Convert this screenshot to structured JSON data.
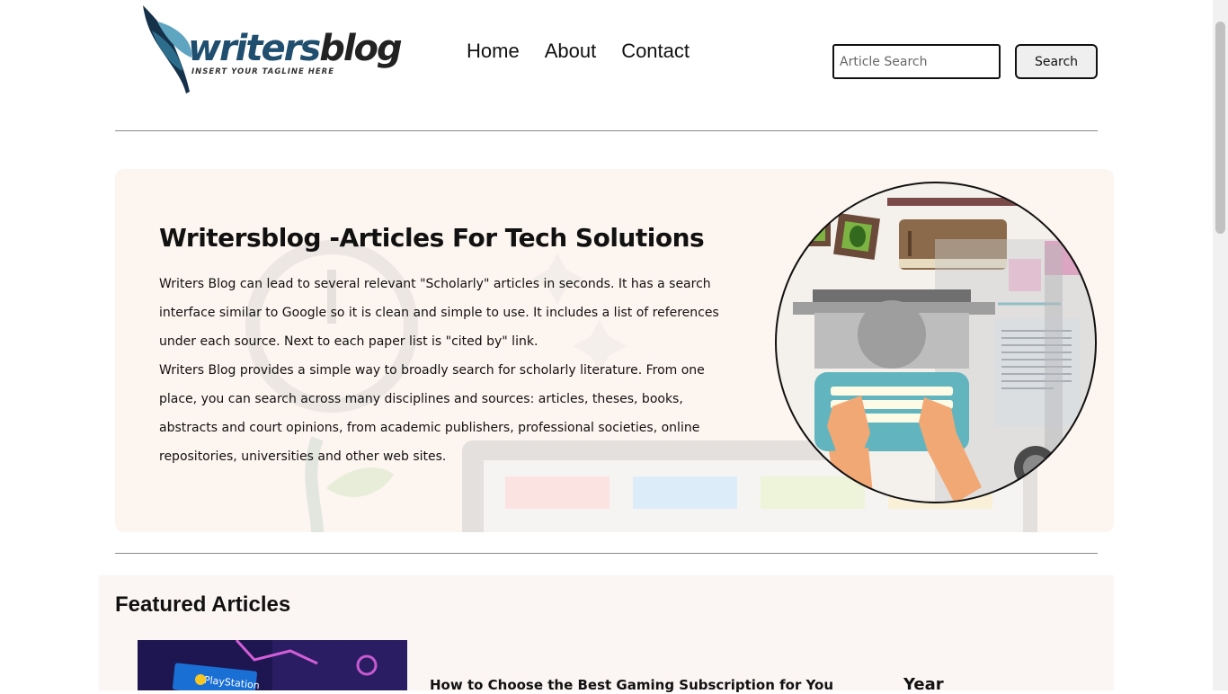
{
  "header": {
    "logo": {
      "brand_first": "writers",
      "brand_second": "blog",
      "tagline": "INSERT YOUR TAGLINE HERE"
    },
    "nav": [
      {
        "label": "Home"
      },
      {
        "label": "About"
      },
      {
        "label": "Contact"
      }
    ],
    "search": {
      "placeholder": "Article Search",
      "value": "",
      "button_label": "Search"
    }
  },
  "hero": {
    "title": "Writersblog -Articles For Tech Solutions",
    "paragraphs": [
      "Writers Blog can lead to several relevant \"Scholarly\" articles in seconds. It has a search interface similar to Google so it is clean and simple to use. It includes a list of references under each source. Next to each paper list is \"cited by\" link.",
      "Writers Blog provides a simple way to broadly search for scholarly literature. From one place, you can search across many disciplines and sources: articles, theses, books, abstracts and court opinions, from academic publishers, professional societies, online repositories, universities and other web sites."
    ],
    "illustration": "typewriter-desk-illustration"
  },
  "featured": {
    "heading": "Featured Articles",
    "articles": [
      {
        "thumb_label": "PlayStation",
        "title": "How to Choose the Best Gaming Subscription for You",
        "column_label": "Year"
      }
    ]
  },
  "colors": {
    "hero_bg": "#fdf5ef",
    "featured_bg": "#fbf5f3",
    "logo_blue": "#1f4e6f",
    "divider": "#8a8a8a"
  }
}
